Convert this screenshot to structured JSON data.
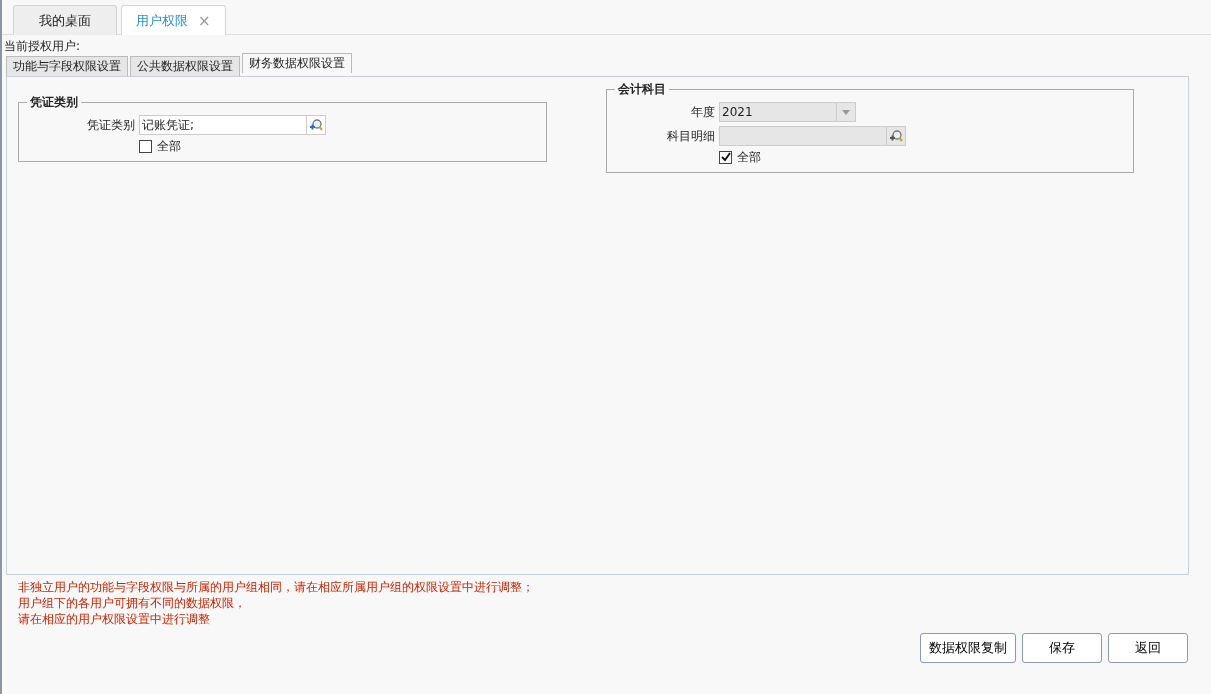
{
  "tabs": [
    {
      "label": "我的桌面",
      "selected": false
    },
    {
      "label": "用户权限",
      "selected": true,
      "close": "×"
    }
  ],
  "current_user_label": "当前授权用户:",
  "sub_tabs": [
    {
      "label": "功能与字段权限设置",
      "selected": false
    },
    {
      "label": "公共数据权限设置",
      "selected": false
    },
    {
      "label": "财务数据权限设置",
      "selected": true
    }
  ],
  "voucher_group": {
    "title": "凭证类别",
    "field_label": "凭证类别",
    "field_value": "记账凭证;",
    "all_label": "全部",
    "all_checked": false
  },
  "account_group": {
    "title": "会计科目",
    "year_label": "年度",
    "year_value": "2021",
    "detail_label": "科目明细",
    "all_label": "全部",
    "all_checked": true
  },
  "messages": [
    "非独立用户的功能与字段权限与所属的用户组相同，请在相应所属用户组的权限设置中进行调整；",
    "用户组下的各用户可拥有不同的数据权限，",
    "请在相应的用户权限设置中进行调整"
  ],
  "buttons": [
    "数据权限复制",
    "保存",
    "返回"
  ]
}
